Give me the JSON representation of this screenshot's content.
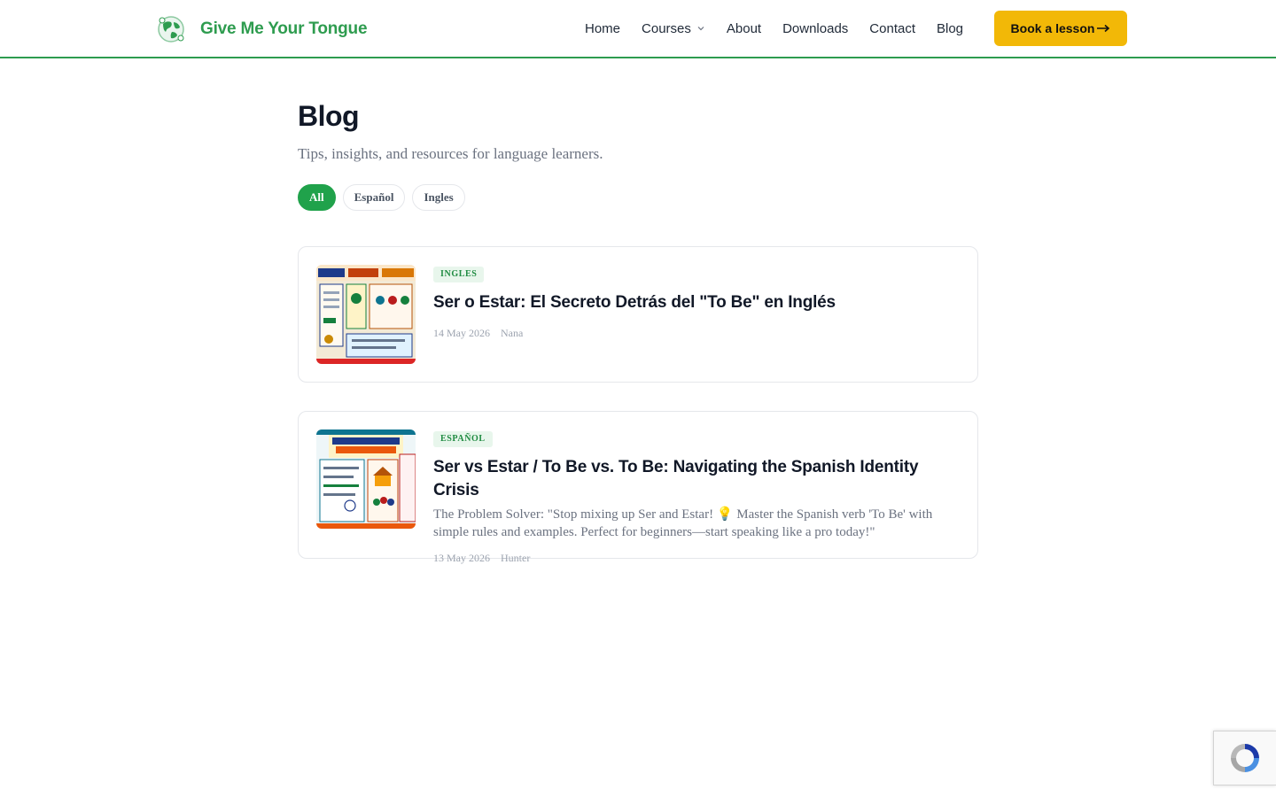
{
  "header": {
    "brand_name": "Give Me Your Tongue",
    "nav": [
      {
        "label": "Home"
      },
      {
        "label": "Courses"
      },
      {
        "label": "About"
      },
      {
        "label": "Downloads"
      },
      {
        "label": "Contact"
      },
      {
        "label": "Blog"
      }
    ],
    "cta_label": "Book a lesson"
  },
  "page": {
    "title": "Blog",
    "subtitle": "Tips, insights, and resources for language learners."
  },
  "filters": [
    {
      "label": "All",
      "active": true
    },
    {
      "label": "Español",
      "active": false
    },
    {
      "label": "Ingles",
      "active": false
    }
  ],
  "posts": [
    {
      "category": "INGLES",
      "title": "Ser o Estar: El Secreto Detrás del \"To Be\" en Inglés",
      "excerpt": "",
      "date": "14 May 2026",
      "author": "Nana"
    },
    {
      "category": "ESPAÑOL",
      "title": "Ser vs Estar / To Be vs. To Be: Navigating the Spanish Identity Crisis",
      "excerpt": "The Problem Solver: \"Stop mixing up Ser and Estar! 💡 Master the Spanish verb 'To Be' with simple rules and examples. Perfect for beginners—start speaking like a pro today!\"",
      "date": "13 May 2026",
      "author": "Hunter"
    }
  ],
  "icons": {
    "logo": "globe-logo-icon",
    "courses_dropdown": "chevron-down-icon",
    "cta_arrow": "arrow-right-icon",
    "recaptcha": "recaptcha-icon"
  },
  "colors": {
    "brand_green": "#2e9c4f",
    "active_chip": "#20a24b",
    "cta_yellow": "#f2b807",
    "badge_bg": "#e8f6ec"
  }
}
